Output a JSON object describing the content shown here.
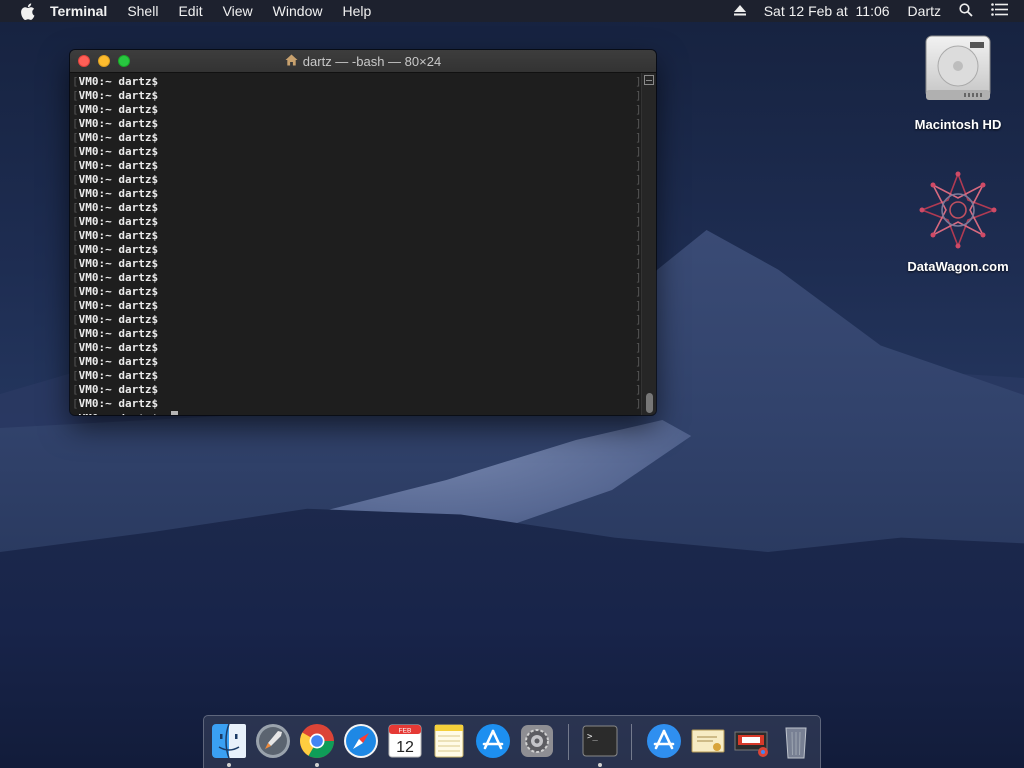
{
  "menubar": {
    "app_name": "Terminal",
    "menus": [
      "Shell",
      "Edit",
      "View",
      "Window",
      "Help"
    ],
    "datetime": "Sat 12 Feb at  11:06",
    "user": "Dartz",
    "icons": [
      "apple-icon",
      "eject-icon",
      "spotlight-search-icon",
      "notification-center-icon"
    ]
  },
  "terminal": {
    "title": "dartz — -bash — 80×24",
    "prompt": "VM0:~ dartz$",
    "history_count": 24,
    "current_input": "c"
  },
  "desktop_icons": [
    {
      "label": "Macintosh HD",
      "icon": "hard-drive-icon"
    },
    {
      "label": "DataWagon.com",
      "icon": "datawagon-logo-icon"
    }
  ],
  "dock": {
    "items": [
      {
        "name": "Finder",
        "icon": "finder-icon",
        "running": true
      },
      {
        "name": "Launchpad",
        "icon": "launchpad-icon",
        "running": false
      },
      {
        "name": "Google Chrome",
        "icon": "chrome-icon",
        "running": true
      },
      {
        "name": "Safari",
        "icon": "safari-icon",
        "running": false
      },
      {
        "name": "Calendar",
        "icon": "calendar-icon",
        "running": false,
        "month": "FEB",
        "day": "12"
      },
      {
        "name": "Notes",
        "icon": "notes-icon",
        "running": false
      },
      {
        "name": "App Store",
        "icon": "app-store-icon",
        "running": false
      },
      {
        "name": "System Preferences",
        "icon": "system-preferences-icon",
        "running": false
      },
      {
        "name": "Terminal",
        "icon": "terminal-icon",
        "running": true
      },
      {
        "name": "Applications",
        "icon": "applications-folder-icon",
        "running": false
      },
      {
        "name": "Certificate",
        "icon": "certificate-icon",
        "running": false
      },
      {
        "name": "Downloads",
        "icon": "downloads-stack-icon",
        "running": false
      },
      {
        "name": "Trash",
        "icon": "trash-icon",
        "running": false
      }
    ]
  }
}
